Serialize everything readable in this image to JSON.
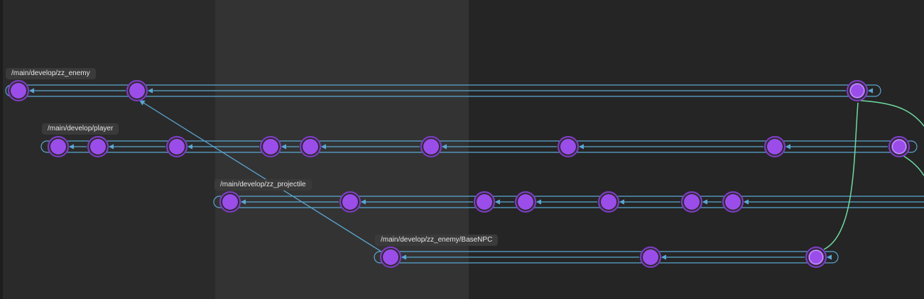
{
  "graph": {
    "colors": {
      "background": "#252525",
      "node_fill": "#9b4dea",
      "node_ring": "#7d3cc2",
      "edge": "#5aa6d1",
      "merge_edge": "#6fd9a0"
    },
    "branches": [
      {
        "id": "zz_enemy",
        "label": "/main/develop/zz_enemy",
        "node_count": 3
      },
      {
        "id": "player",
        "label": "/main/develop/player",
        "node_count": 10
      },
      {
        "id": "zz_projectile",
        "label": "/main/develop/zz_projectile",
        "node_count": 7
      },
      {
        "id": "basenpc",
        "label": "/main/develop/zz_enemy/BaseNPC",
        "node_count": 3
      }
    ]
  }
}
